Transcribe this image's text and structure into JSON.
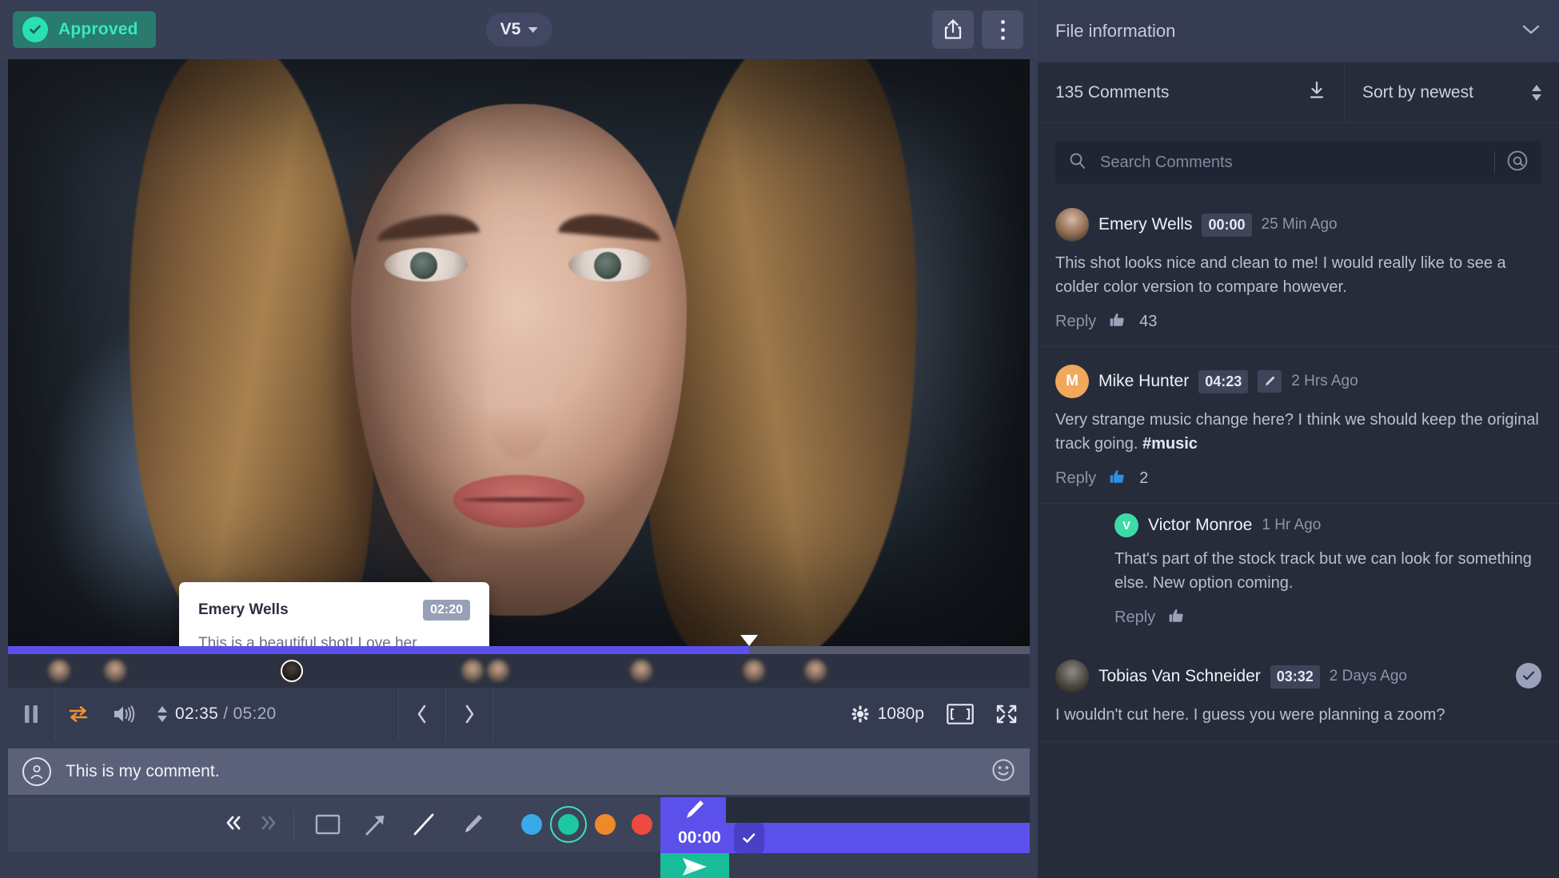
{
  "header": {
    "status_label": "Approved",
    "status_color": "#3ae8bb",
    "version_label": "V5",
    "share_icon": "share-icon",
    "more_icon": "more-vertical-icon"
  },
  "file_panel": {
    "title": "File information",
    "collapse_icon": "chevron-down-icon"
  },
  "comments_header": {
    "count_label": "135 Comments",
    "download_icon": "download-icon",
    "sort_label": "Sort by newest",
    "sort_icon": "sort-updown-icon"
  },
  "search": {
    "placeholder": "Search Comments",
    "search_icon": "search-icon",
    "mention_icon": "at-mention-icon"
  },
  "video_tooltip": {
    "author": "Emery Wells",
    "timecode": "02:20",
    "text": "This is a beautiful shot! Love her expression."
  },
  "player": {
    "current_time": "02:35",
    "separator": "/",
    "total_time": "05:20",
    "quality_label": "1080p",
    "progress_percent": 72.5,
    "play_state_icon": "pause-icon",
    "loop_icon": "loop-icon",
    "volume_icon": "volume-icon",
    "speed_icon": "stepper-icon",
    "prev_icon": "chevron-left-icon",
    "next_icon": "chevron-right-icon",
    "settings_icon": "gear-icon",
    "fit_icon": "fit-screen-icon",
    "fullscreen_icon": "fullscreen-icon",
    "loop_color": "#f0932f",
    "progress_color": "#5b50ea"
  },
  "composer": {
    "value": "This is my comment.",
    "avatar_icon": "user-avatar-icon",
    "emoji_icon": "emoji-icon"
  },
  "annotation_toolbar": {
    "prev_icon": "double-chevron-left-icon",
    "next_icon": "double-chevron-right-icon",
    "tools": [
      {
        "name": "rectangle-tool",
        "icon": "rectangle-icon"
      },
      {
        "name": "arrow-tool",
        "icon": "arrow-icon"
      },
      {
        "name": "line-tool",
        "icon": "line-icon"
      },
      {
        "name": "brush-tool",
        "icon": "brush-icon"
      }
    ],
    "colors": [
      {
        "name": "blue",
        "hex": "#3aa9e8",
        "selected": false
      },
      {
        "name": "green",
        "hex": "#1dc9a0",
        "selected": true
      },
      {
        "name": "orange",
        "hex": "#f0892a",
        "selected": false
      },
      {
        "name": "red",
        "hex": "#ef4a3f",
        "selected": false
      }
    ],
    "draw_icon": "brush-icon",
    "timestamp": "00:00",
    "timestamp_check_icon": "check-icon",
    "send_icon": "send-icon",
    "accent_color": "#5b50ea",
    "send_color": "#18bd9a"
  },
  "comments": [
    {
      "author": "Emery Wells",
      "timecode": "00:00",
      "has_brush": false,
      "ago": "25 Min Ago",
      "text": "This shot looks nice and clean to me! I would really like to see a colder color version to compare however.",
      "reply_label": "Reply",
      "like_count": "43",
      "like_active": false,
      "avatar_type": "photo",
      "resolved": false,
      "is_reply": false
    },
    {
      "author": "Mike Hunter",
      "timecode": "04:23",
      "has_brush": true,
      "ago": "2 Hrs Ago",
      "text": "Very strange music change here? I think we should keep the original track going. ",
      "hashtag": "#music",
      "reply_label": "Reply",
      "like_count": "2",
      "like_active": true,
      "avatar_type": "initial",
      "avatar_initial": "M",
      "avatar_color": "#f0a85a",
      "resolved": false,
      "is_reply": false
    },
    {
      "author": "Victor Monroe",
      "timecode": "",
      "has_brush": false,
      "ago": "1 Hr Ago",
      "text": "That's part of the stock track but we can look for something else. New option coming.",
      "reply_label": "Reply",
      "like_count": "",
      "like_active": false,
      "avatar_type": "initial",
      "avatar_initial": "V",
      "avatar_color": "#3ddba5",
      "resolved": false,
      "is_reply": true
    },
    {
      "author": "Tobias Van Schneider",
      "timecode": "03:32",
      "has_brush": false,
      "ago": "2 Days Ago",
      "text": "I wouldn't cut here. I guess you were planning a zoom?",
      "reply_label": "",
      "like_count": "",
      "like_active": false,
      "avatar_type": "photo2",
      "resolved": true,
      "is_reply": false
    }
  ],
  "timeline_markers": [
    {
      "position": 5.0,
      "active": false
    },
    {
      "position": 10.5,
      "active": false
    },
    {
      "position": 27.8,
      "active": true
    },
    {
      "position": 45.5,
      "active": false
    },
    {
      "position": 48.0,
      "active": false
    },
    {
      "position": 62.0,
      "active": false
    },
    {
      "position": 73.0,
      "active": false
    },
    {
      "position": 79.0,
      "active": false
    }
  ]
}
